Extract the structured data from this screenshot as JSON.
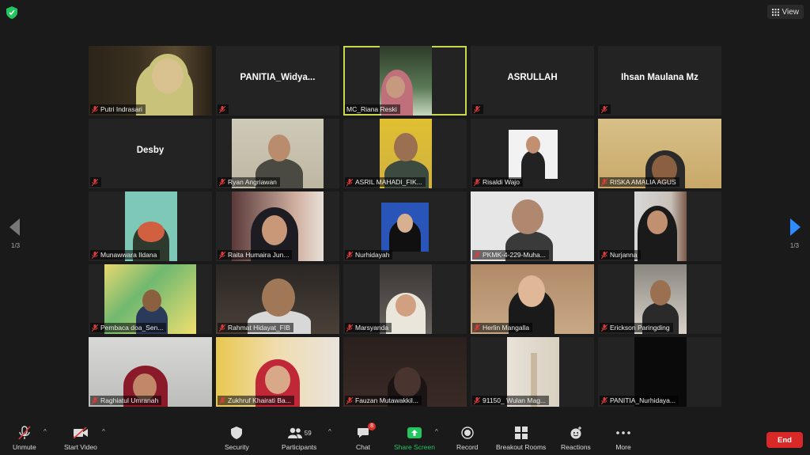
{
  "top": {
    "view_label": "View"
  },
  "pagination": {
    "left": "1/3",
    "right": "1/3"
  },
  "participants": [
    {
      "name": "Putri Indrasari"
    },
    {
      "name": "PANITIA_Widya...",
      "big": "PANITIA_Widya..."
    },
    {
      "name": "MC_Riana Reski"
    },
    {
      "name": "ASRULLAH",
      "big": "ASRULLAH"
    },
    {
      "name": "Ihsan Maulana Mz",
      "big": "Ihsan Maulana Mz"
    },
    {
      "name": "Desby",
      "big": "Desby"
    },
    {
      "name": "Ryan Angriawan"
    },
    {
      "name": "ASRIL MAHADI_FIK..."
    },
    {
      "name": "Risaldi Wajo"
    },
    {
      "name": "RISKA AMALIA AGUS"
    },
    {
      "name": "Munawwara Ildana"
    },
    {
      "name": "Raita Humaira Jun..."
    },
    {
      "name": "Nurhidayah"
    },
    {
      "name": "PKMK-4-229-Muha..."
    },
    {
      "name": "Nurjanna"
    },
    {
      "name": "Pembaca doa_Sen..."
    },
    {
      "name": "Rahmat Hidayat_FIB"
    },
    {
      "name": "Marsyanda"
    },
    {
      "name": "Herlin Mangalla"
    },
    {
      "name": "Erickson Paringding"
    },
    {
      "name": "Raghiatul Umranah"
    },
    {
      "name": "Zukhruf Khairati Ba..."
    },
    {
      "name": "Fauzan Mutawakkil..."
    },
    {
      "name": "91150_ Wulan Mag..."
    },
    {
      "name": "PANITIA_Nurhidaya..."
    }
  ],
  "toolbar": {
    "unmute": "Unmute",
    "start_video": "Start Video",
    "security": "Security",
    "participants": "Participants",
    "participants_count": "59",
    "chat": "Chat",
    "chat_badge": "8",
    "share_screen": "Share Screen",
    "record": "Record",
    "breakout_rooms": "Breakout Rooms",
    "reactions": "Reactions",
    "more": "More",
    "end": "End"
  },
  "colors": {
    "active_border": "#c8d84a",
    "share_green": "#22c55e",
    "end_red": "#d92828",
    "arrow_blue": "#2d8cff"
  }
}
